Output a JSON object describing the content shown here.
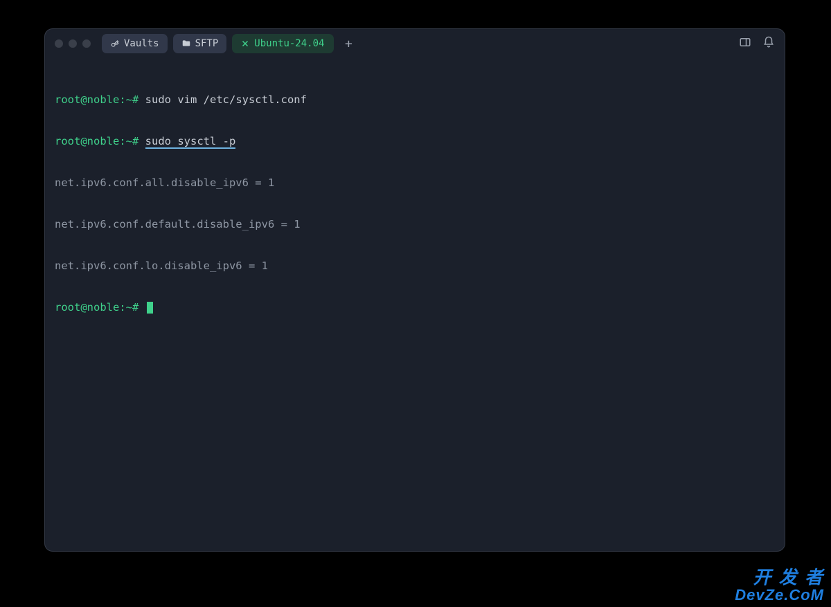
{
  "tabs": [
    {
      "label": "Vaults",
      "icon": "key-icon"
    },
    {
      "label": "SFTP",
      "icon": "folder-icon"
    },
    {
      "label": "Ubuntu-24.04",
      "active": true
    }
  ],
  "new_tab_glyph": "+",
  "terminal": {
    "prompt": "root@noble:~#",
    "lines": [
      {
        "type": "cmd",
        "prompt": "root@noble:~#",
        "command": "sudo vim /etc/sysctl.conf"
      },
      {
        "type": "cmd",
        "prompt": "root@noble:~#",
        "command": "sudo sysctl -p",
        "underline": true
      },
      {
        "type": "out",
        "text": "net.ipv6.conf.all.disable_ipv6 = 1"
      },
      {
        "type": "out",
        "text": "net.ipv6.conf.default.disable_ipv6 = 1"
      },
      {
        "type": "out",
        "text": "net.ipv6.conf.lo.disable_ipv6 = 1"
      },
      {
        "type": "cursor",
        "prompt": "root@noble:~#"
      }
    ]
  },
  "watermark": {
    "line1": "开 发 者",
    "line2": "DevZe.CoM"
  },
  "colors": {
    "bg": "#1b202b",
    "prompt": "#3fd18b",
    "output": "#8e96a3",
    "accent": "#6fb3e0",
    "watermark": "#1f7fe0"
  }
}
